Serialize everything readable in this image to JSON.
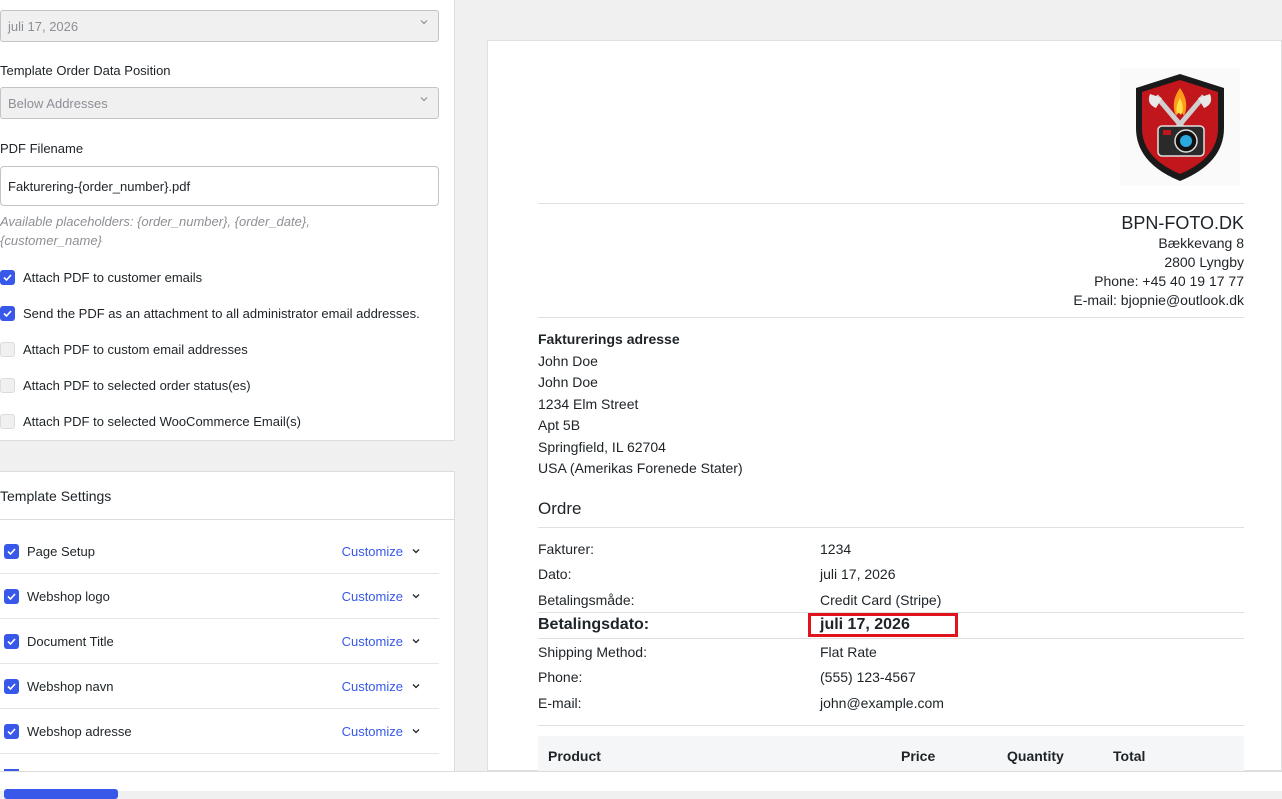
{
  "settings": {
    "date_select_value": "juli 17, 2026",
    "order_data_position_label": "Template Order Data Position",
    "order_data_position_value": "Below Addresses",
    "pdf_filename_label": "PDF Filename",
    "pdf_filename_value": "Fakturering-{order_number}.pdf",
    "placeholders_hint": "Available placeholders: {order_number}, {order_date}, {customer_name}",
    "checkboxes": [
      {
        "label": "Attach PDF to customer emails",
        "checked": true
      },
      {
        "label": "Send the PDF as an attachment to all administrator email addresses.",
        "checked": true
      },
      {
        "label": "Attach PDF to custom email addresses",
        "checked": false
      },
      {
        "label": "Attach PDF to selected order status(es)",
        "checked": false
      },
      {
        "label": "Attach PDF to selected WooCommerce Email(s)",
        "checked": false
      }
    ]
  },
  "template_settings": {
    "title": "Template Settings",
    "customize_label": "Customize",
    "items": [
      {
        "label": "Page Setup"
      },
      {
        "label": "Webshop logo"
      },
      {
        "label": "Document Title"
      },
      {
        "label": "Webshop navn"
      },
      {
        "label": "Webshop adresse"
      }
    ]
  },
  "preview": {
    "shop": {
      "name": "BPN-FOTO.DK",
      "street": "Bækkevang 8",
      "city": "2800 Lyngby",
      "phone": "Phone: +45 40 19 17 77",
      "email": "E-mail: bjopnie@outlook.dk"
    },
    "billing": {
      "title": "Fakturerings adresse",
      "lines": [
        "John Doe",
        "John Doe",
        "1234 Elm Street",
        "Apt 5B",
        "Springfield, IL 62704",
        "USA (Amerikas Forenede Stater)"
      ]
    },
    "order_title": "Ordre",
    "order_rows": [
      {
        "key": "Fakturer:",
        "value": "1234"
      },
      {
        "key": "Dato:",
        "value": "juli 17, 2026"
      },
      {
        "key": "Betalingsmåde:",
        "value": "Credit Card (Stripe)"
      },
      {
        "key": "Betalingsdato:",
        "value": "juli 17, 2026"
      },
      {
        "key": "Shipping Method:",
        "value": "Flat Rate"
      },
      {
        "key": "Phone:",
        "value": "(555) 123-4567"
      },
      {
        "key": "E-mail:",
        "value": "john@example.com"
      }
    ],
    "table_headers": {
      "product": "Product",
      "price": "Price",
      "quantity": "Quantity",
      "total": "Total"
    },
    "highlight_color": "#e0141e"
  }
}
